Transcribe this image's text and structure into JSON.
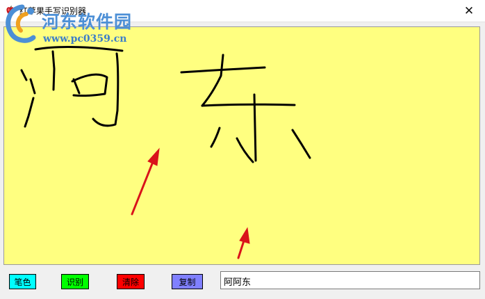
{
  "window": {
    "title": "红苹果手写识别器",
    "close_glyph": "✕"
  },
  "watermark": {
    "site_name": "河东软件园",
    "url": "www.pc0359.cn"
  },
  "buttons": {
    "pen_color": {
      "label": "笔色",
      "bg": "#00ffff"
    },
    "recognize": {
      "label": "识别",
      "bg": "#00ff00"
    },
    "clear": {
      "label": "清除",
      "bg": "#ff0000"
    },
    "copy": {
      "label": "复制",
      "bg": "#8080ff"
    }
  },
  "result": {
    "value": "阿阿东"
  },
  "colors": {
    "canvas_bg": "#ffff80",
    "ink": "#000000",
    "arrow": "#d9131a"
  },
  "icons": {
    "app": "red-apple-icon",
    "close": "close-icon",
    "watermark_logo": "swirl-logo-icon"
  }
}
